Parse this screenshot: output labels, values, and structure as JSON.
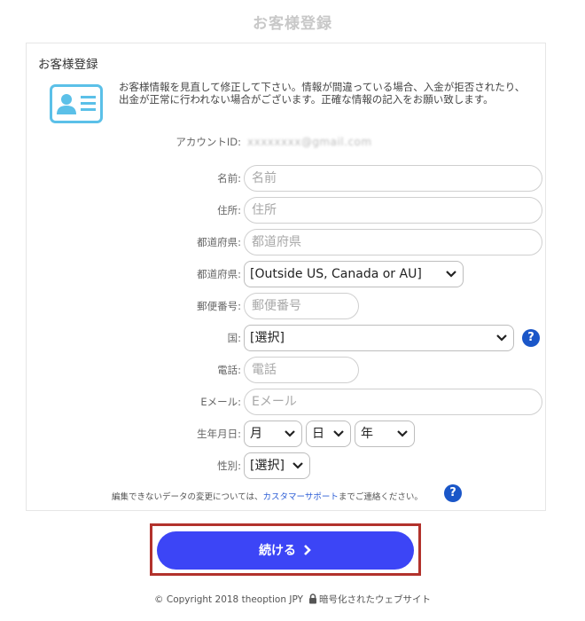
{
  "page": {
    "title": "お客様登録"
  },
  "card": {
    "title": "お客様登録",
    "notice": "お客様情報を見直して修正して下さい。情報が間違っている場合、入金が拒否されたり、出金が正常に行われない場合がございます。正確な情報の記入をお願い致します。"
  },
  "form": {
    "account": {
      "label": "アカウントID:",
      "value": "xxxxxxxx@gmail.com"
    },
    "name": {
      "label": "名前:",
      "placeholder": "名前",
      "value": ""
    },
    "address": {
      "label": "住所:",
      "placeholder": "住所",
      "value": ""
    },
    "prefecture_text": {
      "label": "都道府県:",
      "placeholder": "都道府県",
      "value": ""
    },
    "prefecture_select": {
      "label": "都道府県:",
      "selected": "[Outside US, Canada or AU]"
    },
    "postal": {
      "label": "郵便番号:",
      "placeholder": "郵便番号",
      "value": ""
    },
    "country": {
      "label": "国:",
      "selected": "[選択]",
      "help": "?"
    },
    "phone": {
      "label": "電話:",
      "placeholder": "電話",
      "value": ""
    },
    "email": {
      "label": "Eメール:",
      "placeholder": "Eメール",
      "value": ""
    },
    "birthdate": {
      "label": "生年月日:",
      "month": "月",
      "day": "日",
      "year": "年"
    },
    "gender": {
      "label": "性別:",
      "selected": "[選択]"
    }
  },
  "footnote": {
    "prefix": "編集できないデータの変更については、",
    "link": "カスタマーサポート",
    "suffix": "までご連絡ください。",
    "help": "?"
  },
  "continue": {
    "label": "続ける"
  },
  "footer": {
    "copyright": "© Copyright 2018 theoption JPY",
    "secure": "暗号化されたウェブサイト"
  },
  "colors": {
    "accent": "#3c45f6",
    "help": "#1a56c8",
    "highlight": "#b2322c",
    "icon": "#5bc0e8"
  },
  "icons": {
    "card": "id-card-icon",
    "chevron": "chevron-down-icon",
    "lock": "lock-icon",
    "arrow": "chevron-right-icon"
  }
}
